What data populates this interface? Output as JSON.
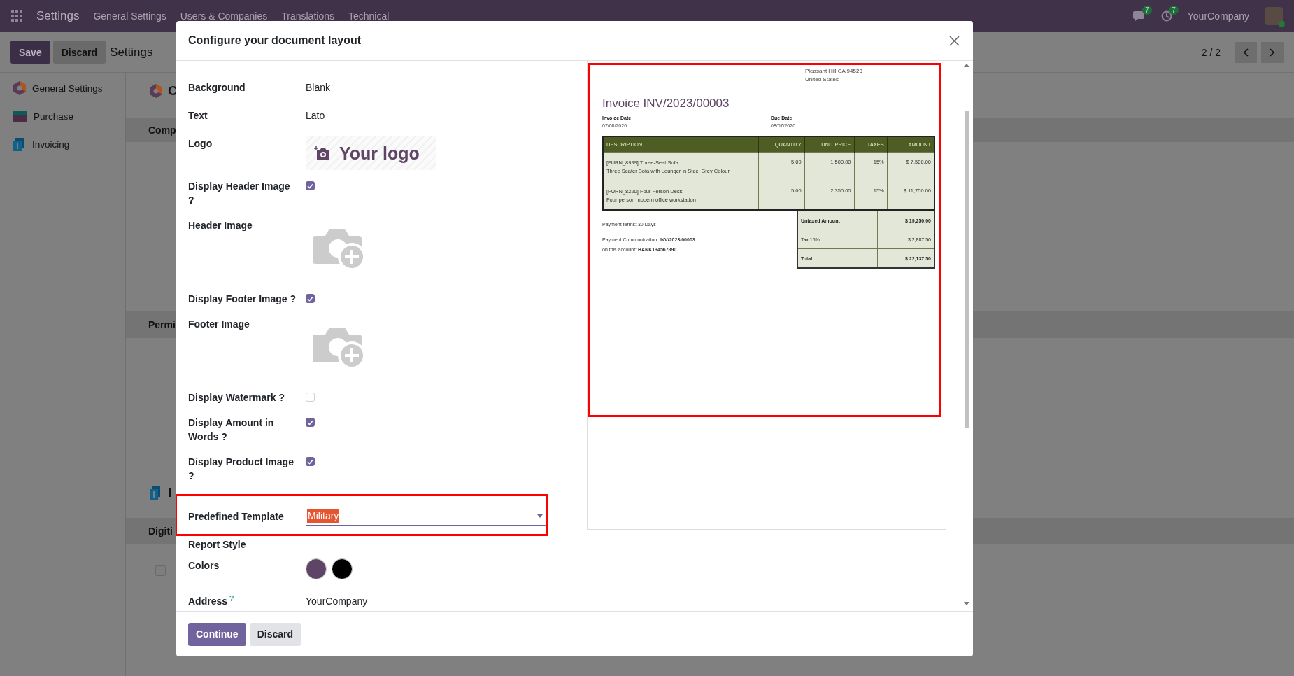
{
  "navbar": {
    "app": "Settings",
    "menu": [
      "General Settings",
      "Users & Companies",
      "Translations",
      "Technical"
    ],
    "chat_badge": "7",
    "activity_badge": "7",
    "company": "YourCompany"
  },
  "control_panel": {
    "save": "Save",
    "discard": "Discard",
    "title": "Settings",
    "pager": "2 / 2"
  },
  "sidebar": {
    "items": [
      {
        "label": "General Settings",
        "kind": "general"
      },
      {
        "label": "Purchase",
        "kind": "purchase"
      },
      {
        "label": "Invoicing",
        "kind": "invoicing"
      }
    ]
  },
  "background": {
    "app_heading": "C",
    "band_1": "Comp",
    "band_2": "Permi",
    "app_heading_2": "I",
    "band_3": "Digiti",
    "checkbox_checked": false
  },
  "dialog": {
    "title": "Configure your document layout",
    "fields": [
      {
        "kind": "text",
        "label": "Background",
        "value": "Blank"
      },
      {
        "kind": "text",
        "label": "Text",
        "value": "Lato"
      },
      {
        "kind": "logo",
        "label": "Logo",
        "value": "Your logo"
      },
      {
        "kind": "checkbox",
        "label": "Display Header Image ?",
        "checked": true
      },
      {
        "kind": "image",
        "label": "Header Image"
      },
      {
        "kind": "checkbox",
        "label": "Display Footer Image ?",
        "checked": true
      },
      {
        "kind": "image",
        "label": "Footer Image"
      },
      {
        "kind": "checkbox",
        "label": "Display Watermark ?",
        "checked": false
      },
      {
        "kind": "checkbox",
        "label": "Display Amount in Words ?",
        "checked": true
      },
      {
        "kind": "checkbox",
        "label": "Display Product Image ?",
        "checked": true
      },
      {
        "kind": "select",
        "label": "Predefined Template",
        "value": "Military",
        "highlighted": true
      },
      {
        "kind": "heading",
        "label": "Report Style"
      },
      {
        "kind": "colors",
        "label": "Colors",
        "colors": [
          {
            "color": "#5f4565"
          },
          {
            "color": "#000000"
          }
        ]
      },
      {
        "kind": "text",
        "label": "Address",
        "help": "?",
        "value": "YourCompany"
      }
    ],
    "buttons": [
      "Continue",
      "Discard"
    ]
  },
  "preview": {
    "address_lines": [
      "Pleasant Hill CA 94523",
      "United States"
    ],
    "title": "Invoice INV/2023/00003",
    "dates": [
      {
        "label": "Invoice Date",
        "value": "07/08/2020"
      },
      {
        "label": "Due Date",
        "value": "08/07/2020"
      }
    ],
    "columns": [
      "DESCRIPTION",
      "QUANTITY",
      "UNIT PRICE",
      "TAXES",
      "AMOUNT"
    ],
    "rows": [
      {
        "name": "[FURN_8999] Three-Seat Sofa",
        "description": "Three Seater Sofa with Lounger in Steel Grey Colour",
        "quantity": "5.00",
        "unit_price": "1,500.00",
        "taxes": "15%",
        "amount": "$ 7,500.00"
      },
      {
        "name": "[FURN_8220] Four Person Desk",
        "description": "Four person modern office workstation",
        "quantity": "5.00",
        "unit_price": "2,350.00",
        "taxes": "15%",
        "amount": "$ 11,750.00"
      }
    ],
    "payment_terms": "Payment terms: 30 Days",
    "communication": [
      "Payment Communication: **INV/2023/00003**",
      "on this account: **BANK134567890**"
    ],
    "totals": [
      {
        "label": "Untaxed Amount",
        "value": "$ 19,250.00",
        "bold": true
      },
      {
        "label": "Tax 15%",
        "value": "$ 2,887.50",
        "bold": false
      },
      {
        "label": "Total",
        "value": "$ 22,137.50",
        "bold": true
      }
    ]
  }
}
